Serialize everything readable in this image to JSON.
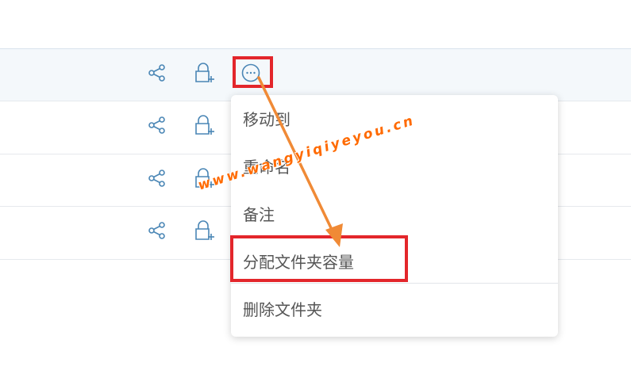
{
  "rows": [
    {
      "name": "row-1",
      "hover": true
    },
    {
      "name": "row-2",
      "hover": false
    },
    {
      "name": "row-3",
      "hover": false
    },
    {
      "name": "row-4",
      "hover": false
    }
  ],
  "row_icons": {
    "share": "share-icon",
    "lock": "lock-add-icon",
    "more": "more-icon"
  },
  "menu": {
    "items": [
      "移动到",
      "重命名",
      "备注",
      "分配文件夹容量",
      "删除文件夹"
    ]
  },
  "watermark": "www.wangyiqiyeyou.cn",
  "colors": {
    "icon": "#4a86b5",
    "highlight": "#e3262b",
    "arrow": "#f08a36",
    "watermark": "#ff6a00",
    "row_hover": "#f4f8fb"
  }
}
